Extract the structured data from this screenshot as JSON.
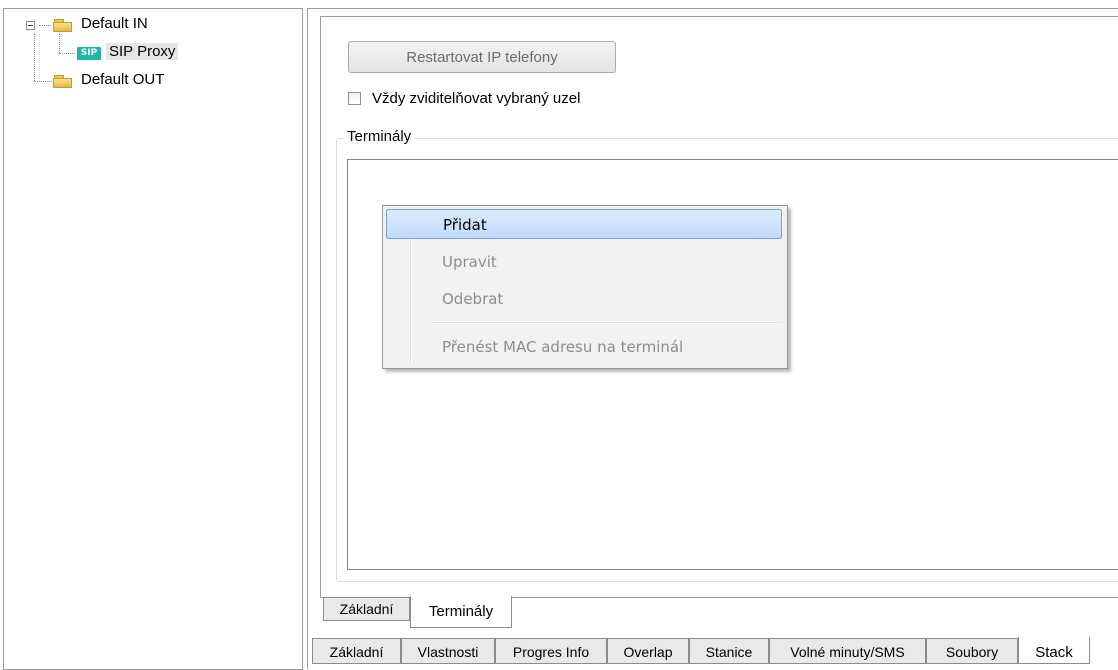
{
  "tree": {
    "items": [
      {
        "label": "Default IN",
        "icon": "folder-icon",
        "expanded": true
      },
      {
        "label": "SIP Proxy",
        "icon": "sip-icon",
        "badge": "SIP",
        "selected": true
      },
      {
        "label": "Default OUT",
        "icon": "folder-icon"
      }
    ]
  },
  "toolbar": {
    "restart_label": "Restartovat IP telefony",
    "always_visible_label": "Vždy zviditelňovat vybraný uzel",
    "always_visible_checked": false
  },
  "terminals_group": {
    "title": "Terminály"
  },
  "context_menu": {
    "items": [
      {
        "label": "Přidat",
        "enabled": true,
        "highlighted": true
      },
      {
        "label": "Upravit",
        "enabled": false
      },
      {
        "label": "Odebrat",
        "enabled": false
      },
      {
        "label": "Přenést MAC adresu na terminál",
        "enabled": false
      }
    ]
  },
  "inner_tabs": [
    {
      "label": "Základní",
      "active": false
    },
    {
      "label": "Terminály",
      "active": true
    }
  ],
  "outer_tabs": [
    {
      "label": "Základní",
      "active": false
    },
    {
      "label": "Vlastnosti",
      "active": false
    },
    {
      "label": "Progres Info",
      "active": false
    },
    {
      "label": "Overlap",
      "active": false
    },
    {
      "label": "Stanice",
      "active": false
    },
    {
      "label": "Volné minuty/SMS",
      "active": false
    },
    {
      "label": "Soubory",
      "active": false
    },
    {
      "label": "Stack",
      "active": true
    }
  ],
  "colors": {
    "highlight": "#c1dbfc",
    "sip_badge": "#1fb5a8",
    "folder": "#e6b948"
  }
}
